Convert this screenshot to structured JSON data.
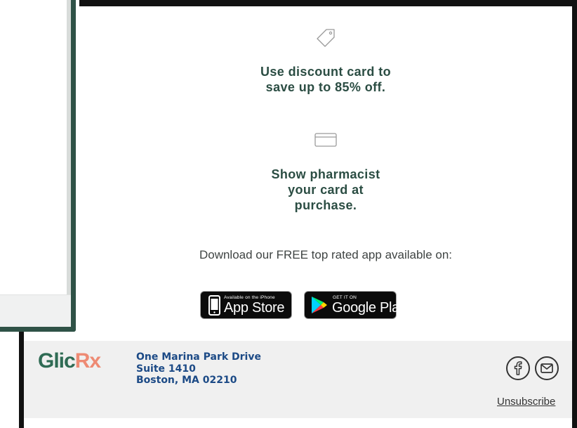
{
  "steps": [
    {
      "icon": "price-tag-icon",
      "text": "Use discount card to save up to 85% off."
    },
    {
      "icon": "card-icon",
      "text": "Show pharmacist your card at purchase."
    }
  ],
  "download": {
    "text": "Download our FREE top rated app available on:"
  },
  "app_store": {
    "small": "Available on the iPhone",
    "big": "App Store"
  },
  "google_play": {
    "small": "GET IT ON",
    "big": "Google Play"
  },
  "footer": {
    "logo_main": "Glic",
    "logo_accent": "Rx",
    "address": [
      "One Marina Park Drive",
      "Suite 1410",
      "Boston, MA 02210"
    ],
    "unsubscribe": "Unsubscribe"
  },
  "colors": {
    "brand_green": "#2f6b54",
    "brand_coral": "#ee8a73",
    "text_green": "#2b4d43",
    "address_blue": "#1c4a86"
  }
}
